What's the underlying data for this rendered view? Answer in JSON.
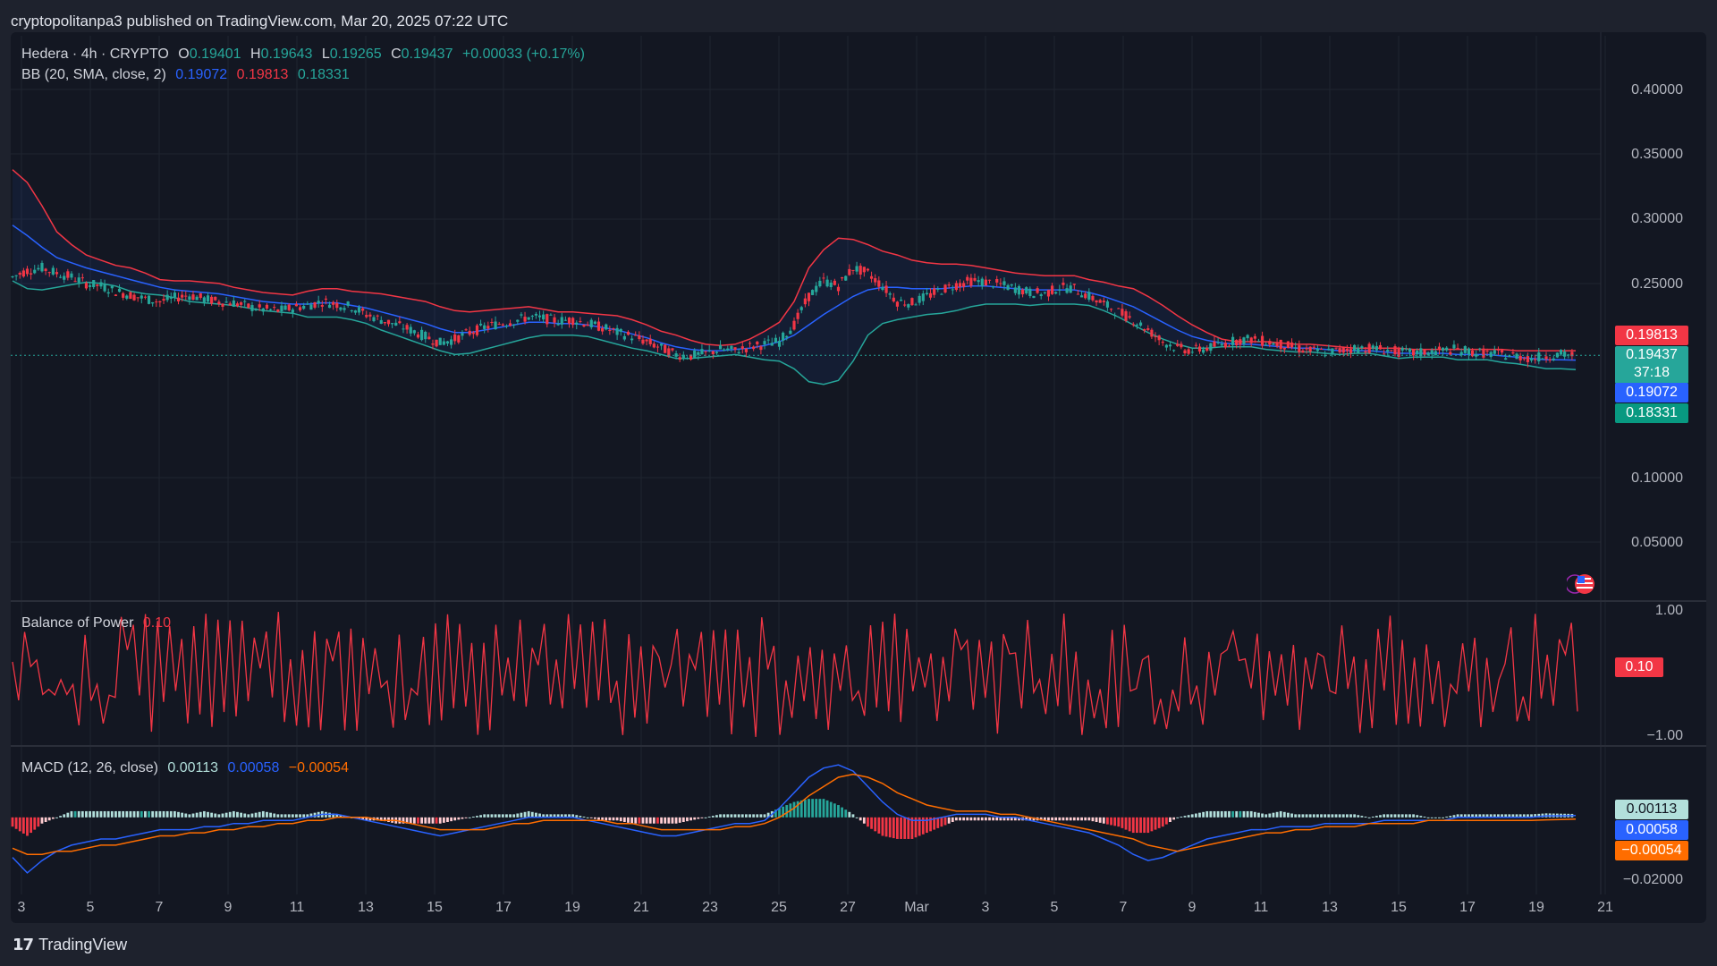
{
  "header": {
    "published_text": "cryptopolitanpa3 published on TradingView.com, Mar 20, 2025 07:22 UTC"
  },
  "legend": {
    "symbol": "Hedera · 4h · CRYPTO",
    "open_label": "O",
    "open": "0.19401",
    "high_label": "H",
    "high": "0.19643",
    "low_label": "L",
    "low": "0.19265",
    "close_label": "C",
    "close": "0.19437",
    "change": "+0.00033 (+0.17%)",
    "bb_title": "BB (20, SMA, close, 2)",
    "bb_basis": "0.19072",
    "bb_upper": "0.19813",
    "bb_lower": "0.18331",
    "bop_title": "Balance of Power",
    "bop_value": "0.10",
    "macd_title": "MACD (12, 26, close)",
    "macd_hist": "0.00113",
    "macd_line": "0.00058",
    "macd_signal": "−0.00054"
  },
  "price_axis": [
    "0.40000",
    "0.35000",
    "0.30000",
    "0.25000",
    "0.10000",
    "0.05000"
  ],
  "price_tags": {
    "upper": "0.19813",
    "close": "0.19437",
    "countdown": "37:18",
    "basis": "0.19072",
    "lower": "0.18331"
  },
  "bop_axis": [
    "1.00",
    "−1.00"
  ],
  "bop_tag": "0.10",
  "macd_axis": [
    "−0.02000"
  ],
  "macd_tags": {
    "hist": "0.00113",
    "macd": "0.00058",
    "signal": "−0.00054"
  },
  "time_axis": [
    "3",
    "5",
    "7",
    "9",
    "11",
    "13",
    "15",
    "17",
    "19",
    "21",
    "23",
    "25",
    "27",
    "Mar",
    "3",
    "5",
    "7",
    "9",
    "11",
    "13",
    "15",
    "17",
    "19",
    "21"
  ],
  "footer": {
    "brand": "TradingView"
  },
  "colors": {
    "up": "#26a69a",
    "down": "#f23645",
    "basis": "#2962ff",
    "upper": "#f23645",
    "lower": "#26a69a",
    "signal": "#ff6d00",
    "bop": "#f23645",
    "background": "#131722"
  },
  "chart_data": {
    "type": "candlestick",
    "price_range": [
      0.0,
      0.42
    ],
    "close_price_series": [
      0.255,
      0.26,
      0.262,
      0.258,
      0.255,
      0.25,
      0.248,
      0.244,
      0.241,
      0.238,
      0.236,
      0.239,
      0.241,
      0.238,
      0.236,
      0.235,
      0.232,
      0.23,
      0.229,
      0.231,
      0.233,
      0.236,
      0.234,
      0.232,
      0.226,
      0.222,
      0.218,
      0.214,
      0.209,
      0.204,
      0.207,
      0.212,
      0.216,
      0.219,
      0.221,
      0.224,
      0.223,
      0.221,
      0.222,
      0.219,
      0.216,
      0.212,
      0.209,
      0.205,
      0.2,
      0.195,
      0.194,
      0.196,
      0.199,
      0.198,
      0.201,
      0.203,
      0.205,
      0.218,
      0.24,
      0.252,
      0.248,
      0.262,
      0.258,
      0.248,
      0.236,
      0.235,
      0.24,
      0.245,
      0.249,
      0.252,
      0.251,
      0.249,
      0.246,
      0.243,
      0.242,
      0.247,
      0.246,
      0.24,
      0.234,
      0.228,
      0.222,
      0.214,
      0.205,
      0.2,
      0.198,
      0.2,
      0.203,
      0.206,
      0.207,
      0.205,
      0.203,
      0.2,
      0.198,
      0.197,
      0.198,
      0.2,
      0.2,
      0.199,
      0.197,
      0.196,
      0.197,
      0.198,
      0.199,
      0.197,
      0.196,
      0.195,
      0.194,
      0.192,
      0.194,
      0.195,
      0.1944
    ],
    "bb_upper_series": [
      0.338,
      0.328,
      0.31,
      0.29,
      0.28,
      0.272,
      0.268,
      0.264,
      0.262,
      0.258,
      0.253,
      0.252,
      0.252,
      0.251,
      0.25,
      0.247,
      0.245,
      0.243,
      0.242,
      0.241,
      0.244,
      0.246,
      0.246,
      0.244,
      0.243,
      0.242,
      0.24,
      0.238,
      0.236,
      0.232,
      0.229,
      0.228,
      0.229,
      0.23,
      0.231,
      0.232,
      0.23,
      0.228,
      0.228,
      0.227,
      0.226,
      0.225,
      0.222,
      0.218,
      0.213,
      0.21,
      0.206,
      0.203,
      0.202,
      0.203,
      0.207,
      0.213,
      0.22,
      0.236,
      0.262,
      0.276,
      0.285,
      0.284,
      0.28,
      0.275,
      0.272,
      0.268,
      0.266,
      0.265,
      0.265,
      0.264,
      0.262,
      0.26,
      0.258,
      0.257,
      0.256,
      0.256,
      0.256,
      0.253,
      0.251,
      0.248,
      0.246,
      0.24,
      0.233,
      0.225,
      0.218,
      0.212,
      0.207,
      0.205,
      0.205,
      0.205,
      0.204,
      0.203,
      0.203,
      0.202,
      0.201,
      0.2,
      0.2,
      0.2,
      0.2,
      0.199,
      0.199,
      0.199,
      0.199,
      0.199,
      0.199,
      0.199,
      0.198,
      0.198,
      0.198,
      0.198,
      0.198
    ],
    "bb_basis_series": [
      0.295,
      0.287,
      0.278,
      0.27,
      0.266,
      0.262,
      0.259,
      0.256,
      0.253,
      0.25,
      0.247,
      0.245,
      0.244,
      0.243,
      0.242,
      0.24,
      0.238,
      0.236,
      0.235,
      0.234,
      0.234,
      0.235,
      0.235,
      0.233,
      0.231,
      0.228,
      0.225,
      0.222,
      0.219,
      0.215,
      0.212,
      0.212,
      0.214,
      0.216,
      0.218,
      0.22,
      0.22,
      0.219,
      0.219,
      0.218,
      0.216,
      0.214,
      0.211,
      0.208,
      0.204,
      0.201,
      0.199,
      0.198,
      0.198,
      0.199,
      0.2,
      0.202,
      0.205,
      0.21,
      0.218,
      0.226,
      0.233,
      0.24,
      0.245,
      0.247,
      0.247,
      0.246,
      0.246,
      0.246,
      0.247,
      0.248,
      0.248,
      0.247,
      0.246,
      0.245,
      0.245,
      0.245,
      0.245,
      0.243,
      0.24,
      0.236,
      0.232,
      0.226,
      0.22,
      0.214,
      0.209,
      0.206,
      0.204,
      0.203,
      0.203,
      0.202,
      0.201,
      0.2,
      0.2,
      0.199,
      0.198,
      0.198,
      0.198,
      0.197,
      0.196,
      0.196,
      0.196,
      0.196,
      0.195,
      0.195,
      0.195,
      0.194,
      0.193,
      0.192,
      0.191,
      0.191,
      0.1907
    ],
    "bb_lower_series": [
      0.252,
      0.246,
      0.245,
      0.247,
      0.249,
      0.251,
      0.25,
      0.248,
      0.244,
      0.242,
      0.241,
      0.239,
      0.236,
      0.235,
      0.234,
      0.233,
      0.231,
      0.229,
      0.228,
      0.227,
      0.224,
      0.224,
      0.224,
      0.222,
      0.219,
      0.214,
      0.21,
      0.206,
      0.202,
      0.198,
      0.195,
      0.196,
      0.199,
      0.202,
      0.205,
      0.208,
      0.21,
      0.21,
      0.21,
      0.209,
      0.206,
      0.203,
      0.2,
      0.198,
      0.195,
      0.192,
      0.192,
      0.193,
      0.194,
      0.195,
      0.193,
      0.191,
      0.19,
      0.184,
      0.174,
      0.172,
      0.175,
      0.19,
      0.21,
      0.219,
      0.222,
      0.224,
      0.226,
      0.227,
      0.229,
      0.232,
      0.234,
      0.234,
      0.234,
      0.233,
      0.234,
      0.234,
      0.234,
      0.233,
      0.229,
      0.224,
      0.218,
      0.212,
      0.207,
      0.203,
      0.2,
      0.2,
      0.201,
      0.201,
      0.201,
      0.199,
      0.198,
      0.197,
      0.197,
      0.196,
      0.195,
      0.196,
      0.196,
      0.194,
      0.192,
      0.193,
      0.193,
      0.193,
      0.191,
      0.191,
      0.191,
      0.189,
      0.188,
      0.186,
      0.184,
      0.184,
      0.1833
    ],
    "macd_range": [
      -0.025,
      0.022
    ],
    "macd_series": [
      -0.013,
      -0.018,
      -0.014,
      -0.011,
      -0.009,
      -0.008,
      -0.007,
      -0.007,
      -0.006,
      -0.005,
      -0.004,
      -0.004,
      -0.004,
      -0.003,
      -0.003,
      -0.002,
      -0.002,
      -0.001,
      -0.001,
      -0.001,
      0.0,
      0.001,
      0.001,
      0.0,
      -0.001,
      -0.002,
      -0.003,
      -0.004,
      -0.005,
      -0.006,
      -0.005,
      -0.004,
      -0.003,
      -0.002,
      -0.001,
      0.0,
      0.0,
      0.0,
      0.0,
      -0.001,
      -0.002,
      -0.003,
      -0.004,
      -0.005,
      -0.006,
      -0.006,
      -0.005,
      -0.004,
      -0.003,
      -0.002,
      -0.002,
      -0.001,
      0.003,
      0.008,
      0.013,
      0.016,
      0.017,
      0.015,
      0.01,
      0.005,
      0.001,
      -0.001,
      -0.001,
      0.0,
      0.001,
      0.001,
      0.001,
      0.0,
      0.0,
      -0.001,
      -0.002,
      -0.003,
      -0.004,
      -0.005,
      -0.007,
      -0.009,
      -0.012,
      -0.014,
      -0.013,
      -0.011,
      -0.009,
      -0.007,
      -0.006,
      -0.005,
      -0.004,
      -0.004,
      -0.003,
      -0.003,
      -0.003,
      -0.002,
      -0.002,
      -0.002,
      -0.002,
      -0.001,
      -0.001,
      -0.001,
      -0.001,
      -0.001,
      0.0,
      0.0,
      0.0,
      0.0,
      0.0,
      0.0,
      0.0005,
      0.0005,
      0.00058
    ],
    "signal_series": [
      -0.01,
      -0.012,
      -0.012,
      -0.011,
      -0.011,
      -0.01,
      -0.009,
      -0.009,
      -0.008,
      -0.007,
      -0.006,
      -0.006,
      -0.005,
      -0.005,
      -0.004,
      -0.004,
      -0.003,
      -0.003,
      -0.002,
      -0.002,
      -0.001,
      -0.001,
      0.0,
      0.0,
      0.0,
      -0.001,
      -0.001,
      -0.002,
      -0.003,
      -0.004,
      -0.004,
      -0.004,
      -0.004,
      -0.003,
      -0.002,
      -0.002,
      -0.001,
      -0.001,
      -0.001,
      -0.001,
      -0.001,
      -0.002,
      -0.002,
      -0.003,
      -0.004,
      -0.004,
      -0.004,
      -0.004,
      -0.004,
      -0.003,
      -0.003,
      -0.002,
      0.0,
      0.003,
      0.007,
      0.01,
      0.013,
      0.014,
      0.013,
      0.011,
      0.008,
      0.006,
      0.004,
      0.003,
      0.002,
      0.002,
      0.002,
      0.001,
      0.001,
      0.0,
      -0.001,
      -0.002,
      -0.003,
      -0.004,
      -0.005,
      -0.006,
      -0.007,
      -0.009,
      -0.01,
      -0.011,
      -0.01,
      -0.009,
      -0.008,
      -0.007,
      -0.006,
      -0.005,
      -0.005,
      -0.004,
      -0.004,
      -0.003,
      -0.003,
      -0.003,
      -0.002,
      -0.002,
      -0.002,
      -0.002,
      -0.001,
      -0.001,
      -0.001,
      -0.001,
      -0.001,
      -0.001,
      -0.001,
      -0.001,
      -0.0008,
      -0.0007,
      -0.00054
    ]
  }
}
